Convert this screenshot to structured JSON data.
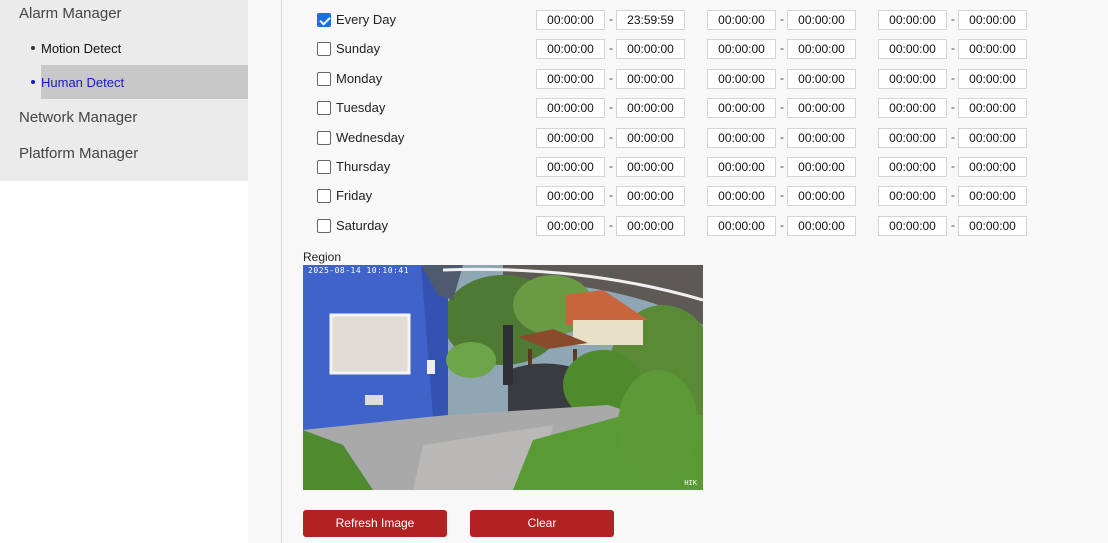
{
  "sidebar": {
    "items": [
      {
        "label": "Alarm Manager"
      },
      {
        "label": "Motion Detect"
      },
      {
        "label": "Human Detect"
      },
      {
        "label": "Network Manager"
      },
      {
        "label": "Platform Manager"
      }
    ],
    "active_item": "Human Detect"
  },
  "schedule": {
    "separator": "-",
    "rows": [
      {
        "day": "Every Day",
        "checked": true,
        "t": [
          "00:00:00",
          "23:59:59",
          "00:00:00",
          "00:00:00",
          "00:00:00",
          "00:00:00"
        ]
      },
      {
        "day": "Sunday",
        "checked": false,
        "t": [
          "00:00:00",
          "00:00:00",
          "00:00:00",
          "00:00:00",
          "00:00:00",
          "00:00:00"
        ]
      },
      {
        "day": "Monday",
        "checked": false,
        "t": [
          "00:00:00",
          "00:00:00",
          "00:00:00",
          "00:00:00",
          "00:00:00",
          "00:00:00"
        ]
      },
      {
        "day": "Tuesday",
        "checked": false,
        "t": [
          "00:00:00",
          "00:00:00",
          "00:00:00",
          "00:00:00",
          "00:00:00",
          "00:00:00"
        ]
      },
      {
        "day": "Wednesday",
        "checked": false,
        "t": [
          "00:00:00",
          "00:00:00",
          "00:00:00",
          "00:00:00",
          "00:00:00",
          "00:00:00"
        ]
      },
      {
        "day": "Thursday",
        "checked": false,
        "t": [
          "00:00:00",
          "00:00:00",
          "00:00:00",
          "00:00:00",
          "00:00:00",
          "00:00:00"
        ]
      },
      {
        "day": "Friday",
        "checked": false,
        "t": [
          "00:00:00",
          "00:00:00",
          "00:00:00",
          "00:00:00",
          "00:00:00",
          "00:00:00"
        ]
      },
      {
        "day": "Saturday",
        "checked": false,
        "t": [
          "00:00:00",
          "00:00:00",
          "00:00:00",
          "00:00:00",
          "00:00:00",
          "00:00:00"
        ]
      }
    ]
  },
  "region": {
    "label": "Region",
    "timestamp": "2025-08-14 10:10:41",
    "channel": "HIK"
  },
  "buttons": {
    "refresh": "Refresh Image",
    "clear": "Clear"
  },
  "colors": {
    "accent_button": "#b22222",
    "active_link": "#1a1acc",
    "checkbox_checked": "#1a6ee8",
    "sidebar_bg": "#ebebeb",
    "active_item_bg": "#c8c8c8"
  },
  "icons": {
    "checkbox": "check-icon",
    "bullet": "bullet-dot-icon"
  }
}
